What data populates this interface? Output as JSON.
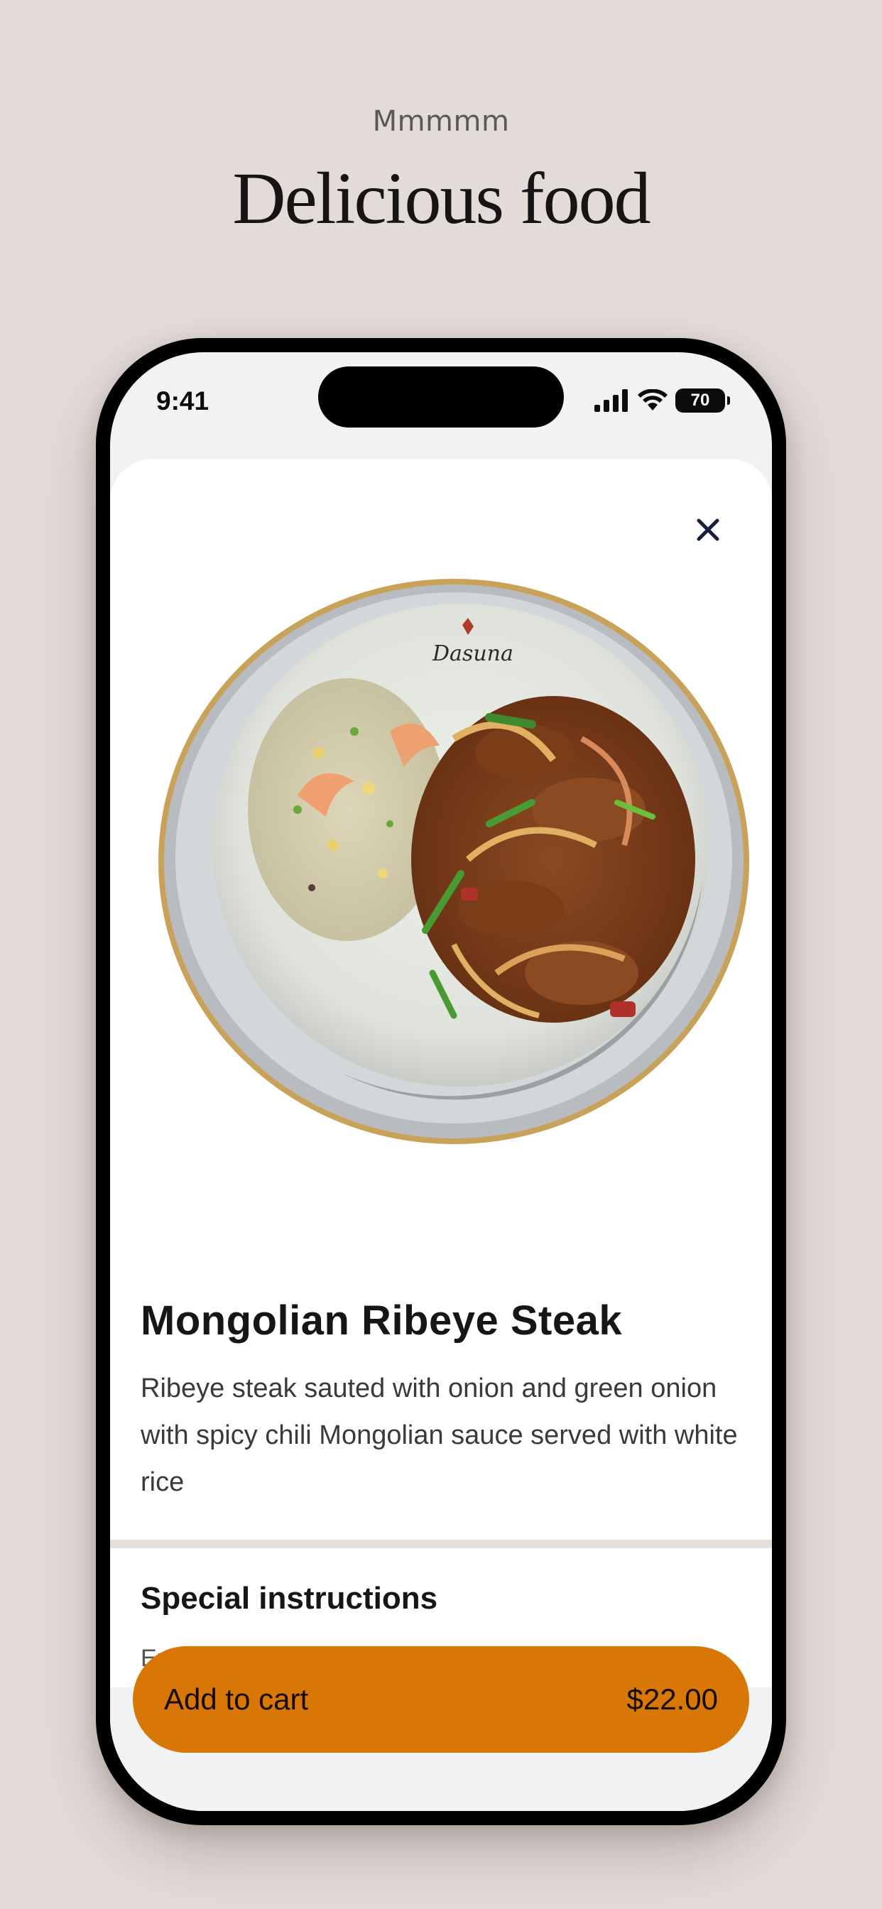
{
  "promo": {
    "kicker": "Mmmmm",
    "title": "Delicious food"
  },
  "status_bar": {
    "time": "9:41",
    "battery": "70",
    "icons": [
      "signal-icon",
      "wifi-icon",
      "battery-icon"
    ]
  },
  "item": {
    "name": "Mongolian Ribeye Steak",
    "description": "Ribeye steak sauted with onion and green onion with spicy chili Mongolian sauce served with white rice",
    "image_logo_text": "Dasuna"
  },
  "special_instructions": {
    "heading": "Special instructions",
    "placeholder": "Enter special requests"
  },
  "cart": {
    "label": "Add to cart",
    "price": "$22.00"
  },
  "colors": {
    "background": "#e3dbd8",
    "accent": "#d97706",
    "text": "#161616"
  }
}
